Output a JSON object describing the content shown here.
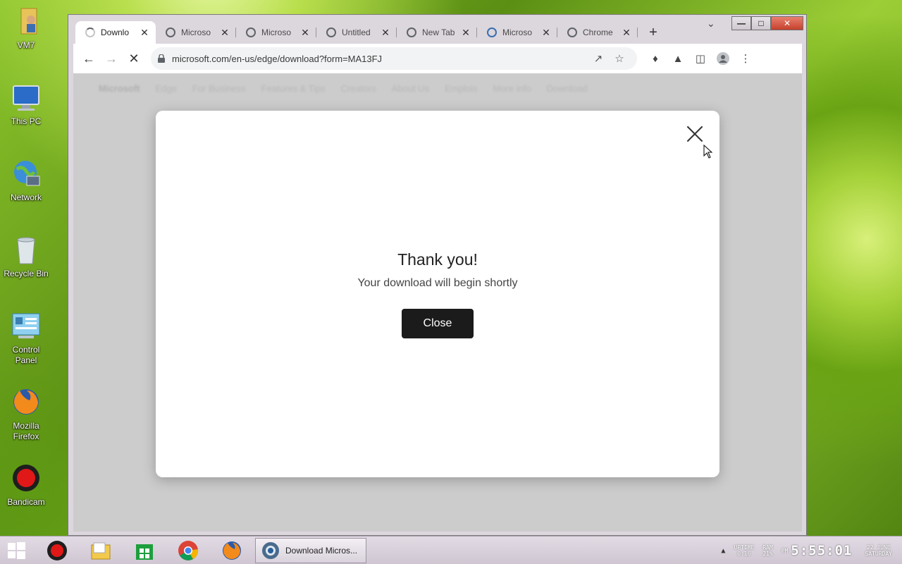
{
  "desktop": {
    "icons": [
      {
        "label": "VM7",
        "icon": "user-folder-icon"
      },
      {
        "label": "This PC",
        "icon": "computer-icon"
      },
      {
        "label": "Network",
        "icon": "network-globe-icon"
      },
      {
        "label": "Recycle Bin",
        "icon": "recycle-bin-icon"
      },
      {
        "label": "Control Panel",
        "icon": "control-panel-icon"
      },
      {
        "label": "Mozilla Firefox",
        "icon": "firefox-icon"
      },
      {
        "label": "Bandicam",
        "icon": "bandicam-icon"
      }
    ]
  },
  "browser": {
    "tabs": [
      {
        "title": "Downlo",
        "active": true,
        "loading": true
      },
      {
        "title": "Microso",
        "active": false
      },
      {
        "title": "Microso",
        "active": false
      },
      {
        "title": "Untitled",
        "active": false
      },
      {
        "title": "New Tab",
        "active": false
      },
      {
        "title": "Microso",
        "active": false
      },
      {
        "title": "Chrome",
        "active": false
      }
    ],
    "url": "microsoft.com/en-us/edge/download?form=MA13FJ"
  },
  "background_nav": [
    "Microsoft",
    "Edge",
    "For Business",
    "Features & Tips",
    "Creators",
    "About Us",
    "Emplois",
    "More info",
    "Download"
  ],
  "modal": {
    "heading": "Thank you!",
    "message": "Your download will begin shortly",
    "close_label": "Close"
  },
  "taskbar": {
    "active_task": "Download Micros...",
    "uptime_label": "UPTIME",
    "uptime_value": "0:16",
    "ram_label": "RAM",
    "ram_value": "21%",
    "ampm": "PM",
    "time": "5:55:01",
    "date": "22 JUNE",
    "day": "SATURDAY"
  },
  "colors": {
    "modal_button": "#1b1b1b",
    "window_close": "#c5412c"
  }
}
